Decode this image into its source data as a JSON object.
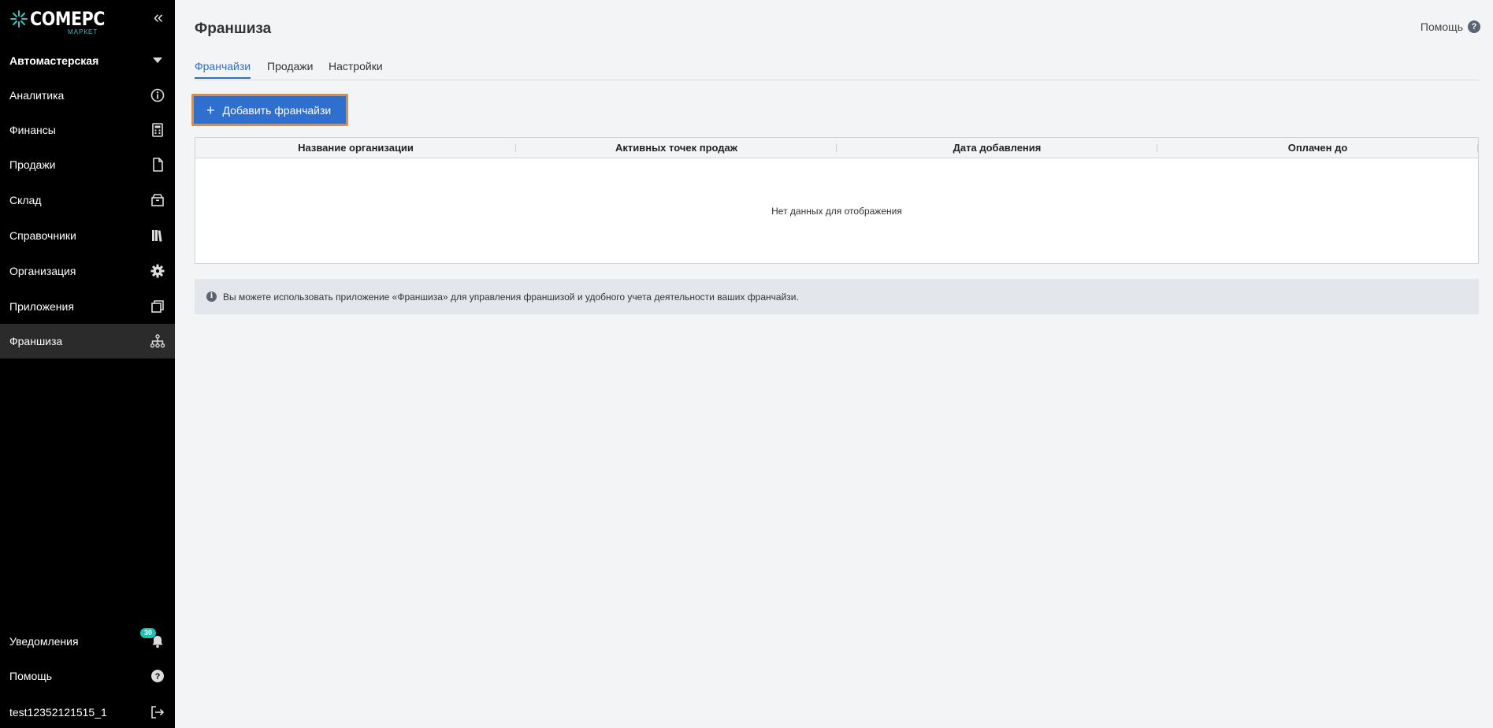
{
  "brand": {
    "name": "COMEPC",
    "sub": "МАРКЕТ",
    "accent": "#2ec4c4"
  },
  "sidebar": {
    "collapse_icon": "double-chevron-left-icon",
    "store": "Автомастерская",
    "items": [
      {
        "label": "Аналитика",
        "icon": "analytics-icon"
      },
      {
        "label": "Финансы",
        "icon": "calculator-icon"
      },
      {
        "label": "Продажи",
        "icon": "document-icon"
      },
      {
        "label": "Склад",
        "icon": "box-icon"
      },
      {
        "label": "Справочники",
        "icon": "books-icon"
      },
      {
        "label": "Организация",
        "icon": "gear-icon"
      },
      {
        "label": "Приложения",
        "icon": "windows-icon"
      },
      {
        "label": "Франшиза",
        "icon": "hierarchy-icon",
        "active": true
      }
    ],
    "bottom": {
      "notifications": {
        "label": "Уведомления",
        "badge": "30",
        "icon": "bell-icon"
      },
      "help": {
        "label": "Помощь",
        "icon": "help-circle-icon"
      },
      "user": {
        "label": "test12352121515_1",
        "icon": "logout-icon"
      }
    }
  },
  "header": {
    "title": "Франшиза",
    "help_label": "Помощь",
    "help_icon": "?"
  },
  "tabs": [
    {
      "label": "Франчайзи",
      "active": true
    },
    {
      "label": "Продажи"
    },
    {
      "label": "Настройки"
    }
  ],
  "toolbar": {
    "add_label": "Добавить франчайзи",
    "add_icon": "+",
    "highlight_color": "#f08a1c",
    "button_color": "#2f6fcf"
  },
  "table": {
    "columns": [
      "Название организации",
      "Активных точек продаж",
      "Дата добавления",
      "Оплачен до"
    ],
    "rows": [],
    "empty_text": "Нет данных для отображения"
  },
  "info": {
    "icon": "i",
    "text": "Вы можете использовать приложение «Франшиза» для управления франшизой и удобного учета деятельности ваших франчайзи."
  }
}
